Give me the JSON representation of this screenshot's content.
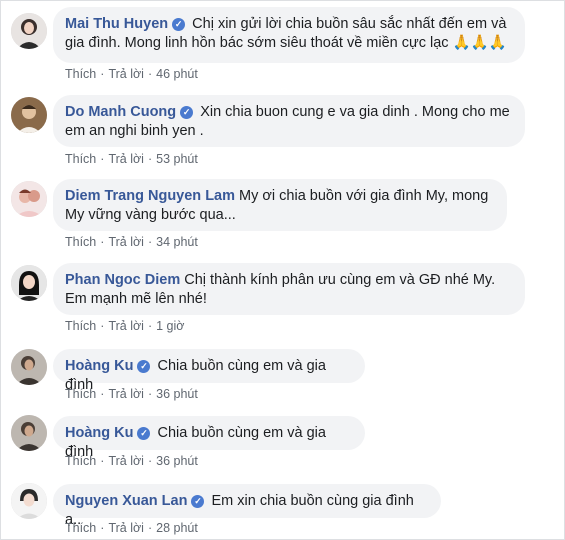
{
  "colors": {
    "author": "#385898",
    "bubble": "#f2f3f5",
    "meta": "#606770",
    "verified": "#4a7acf"
  },
  "actions": {
    "like": "Thích",
    "reply": "Trả lời",
    "sep": "·"
  },
  "verified_mark": "✓",
  "comments": [
    {
      "author": "Mai Thu Huyen",
      "verified": true,
      "text": "Chị xin gửi lời chia buồn sâu sắc nhất đến em và gia đình. Mong linh hồn bác sớm siêu thoát về miền cực lạc",
      "emoji": "🙏🙏🙏",
      "time": "46 phút",
      "avatar_icon": "profile-photo-icon"
    },
    {
      "author": "Do Manh Cuong",
      "verified": true,
      "text": "Xin chia buon cung e va gia dinh . Mong cho me em an nghi binh yen .",
      "time": "53 phút",
      "avatar_icon": "profile-photo-icon"
    },
    {
      "author": "Diem Trang Nguyen Lam",
      "verified": false,
      "text": "My ơi chia buồn với gia đình My, mong My vững vàng bước qua...",
      "time": "34 phút",
      "avatar_icon": "profile-photo-icon"
    },
    {
      "author": "Phan Ngoc Diem",
      "verified": false,
      "text": "Chị thành kính phân ưu cùng em và GĐ nhé My. Em mạnh mẽ lên nhé!",
      "time": "1 giờ",
      "avatar_icon": "profile-photo-icon"
    },
    {
      "author": "Hoàng Ku",
      "verified": true,
      "text": "Chia buồn cùng em và gia đình",
      "time": "36 phút",
      "avatar_icon": "profile-photo-icon"
    },
    {
      "author": "Hoàng Ku",
      "verified": true,
      "text": "Chia buồn cùng em và gia đình",
      "time": "36 phút",
      "avatar_icon": "profile-photo-icon"
    },
    {
      "author": "Nguyen Xuan Lan",
      "verified": true,
      "text": "Em xin chia buồn cùng gia đình ạ..",
      "time": "28 phút",
      "avatar_icon": "profile-photo-icon"
    }
  ]
}
